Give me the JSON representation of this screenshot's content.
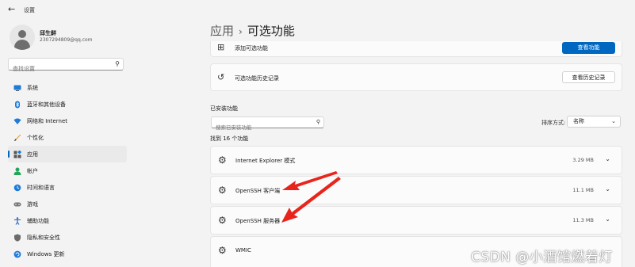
{
  "window": {
    "back_icon": "back-arrow-icon",
    "title": "设置"
  },
  "user": {
    "name": "邱生鲜",
    "email": "2307294809@qq.com"
  },
  "search": {
    "placeholder": "查找设置"
  },
  "sidebar": {
    "items": [
      {
        "label": "系统",
        "icon": "monitor-icon",
        "active": false
      },
      {
        "label": "蓝牙和其他设备",
        "icon": "bluetooth-icon",
        "active": false
      },
      {
        "label": "网络和 Internet",
        "icon": "wifi-icon",
        "active": false
      },
      {
        "label": "个性化",
        "icon": "brush-icon",
        "active": false
      },
      {
        "label": "应用",
        "icon": "apps-icon",
        "active": true
      },
      {
        "label": "帐户",
        "icon": "person-icon",
        "active": false
      },
      {
        "label": "时间和语言",
        "icon": "globe-clock-icon",
        "active": false
      },
      {
        "label": "游戏",
        "icon": "gamepad-icon",
        "active": false
      },
      {
        "label": "辅助功能",
        "icon": "accessibility-icon",
        "active": false
      },
      {
        "label": "隐私和安全性",
        "icon": "shield-icon",
        "active": false
      },
      {
        "label": "Windows 更新",
        "icon": "windows-update-icon",
        "active": false
      }
    ]
  },
  "main": {
    "breadcrumb": {
      "parent": "应用",
      "separator": "›",
      "current": "可选功能"
    },
    "add_feature": {
      "label": "添加可选功能",
      "button": "查看功能"
    },
    "history": {
      "label": "可选功能历史记录",
      "button": "查看历史记录"
    },
    "installed": {
      "heading": "已安装功能",
      "search_placeholder": "搜索已安装功能",
      "sort_label": "排序方式:",
      "sort_value": "名称",
      "count_text": "找到 16 个功能",
      "features": [
        {
          "name": "Internet Explorer 模式",
          "size": "3.29 MB"
        },
        {
          "name": "OpenSSH 客户端",
          "size": "11.1 MB"
        },
        {
          "name": "OpenSSH 服务器",
          "size": "11.3 MB"
        },
        {
          "name": "WMIC",
          "size": ""
        }
      ]
    }
  },
  "annotations": {
    "arrow_color": "#e8241c"
  },
  "watermark": "CSDN @小酒馆燃着灯",
  "colors": {
    "accent": "#0067c0",
    "background": "#f3f3f3",
    "card": "#fbfbfb"
  }
}
